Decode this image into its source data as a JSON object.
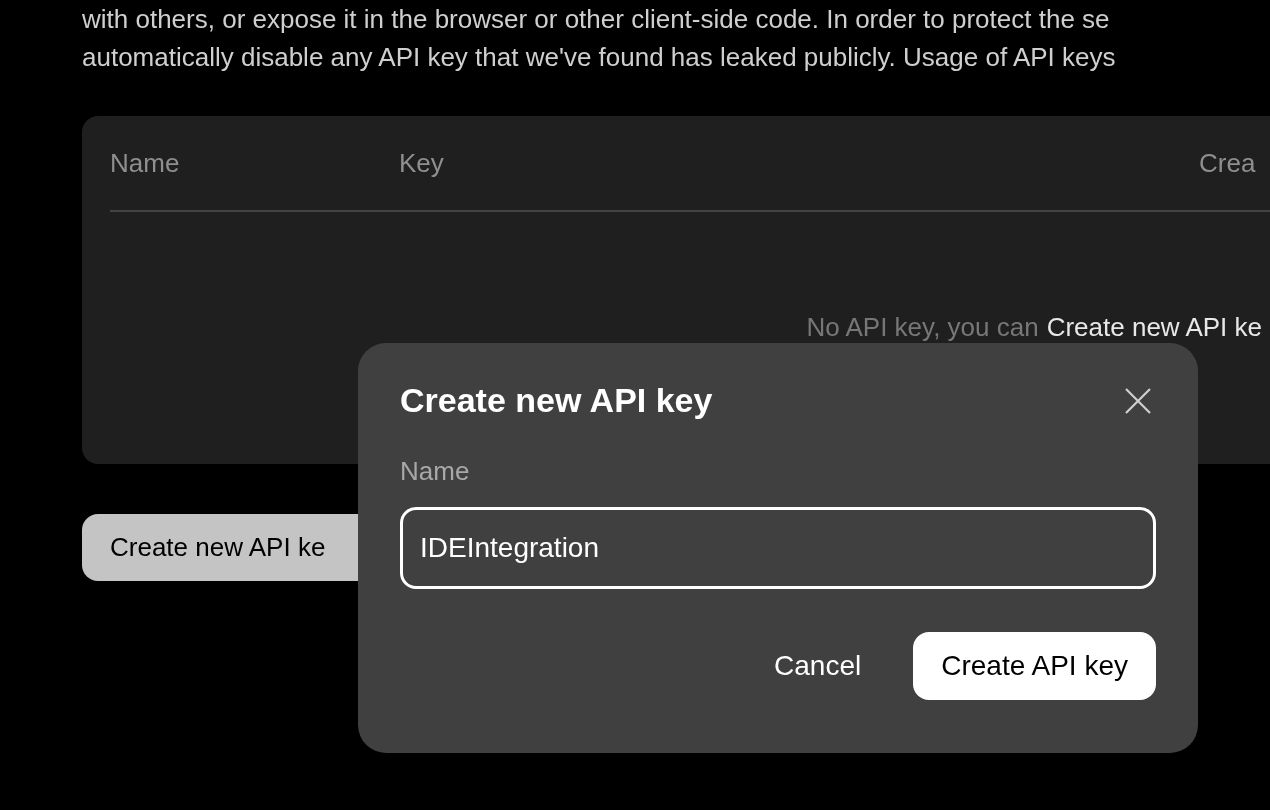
{
  "description_lines": [
    "with others, or expose it in the browser or other client-side code. In order to protect the se",
    "automatically disable any API key that we've found has leaked publicly. Usage of API keys"
  ],
  "table": {
    "columns": [
      "Name",
      "Key",
      "Crea"
    ],
    "empty_text": "No API key, you can",
    "empty_link": "Create new API ke"
  },
  "create_button": "Create new API ke",
  "dialog": {
    "title": "Create new API key",
    "field_label": "Name",
    "field_value": "IDEIntegration",
    "buttons": [
      {
        "label": "Cancel",
        "kind": "secondary"
      },
      {
        "label": "Create API key",
        "kind": "primary"
      }
    ]
  }
}
